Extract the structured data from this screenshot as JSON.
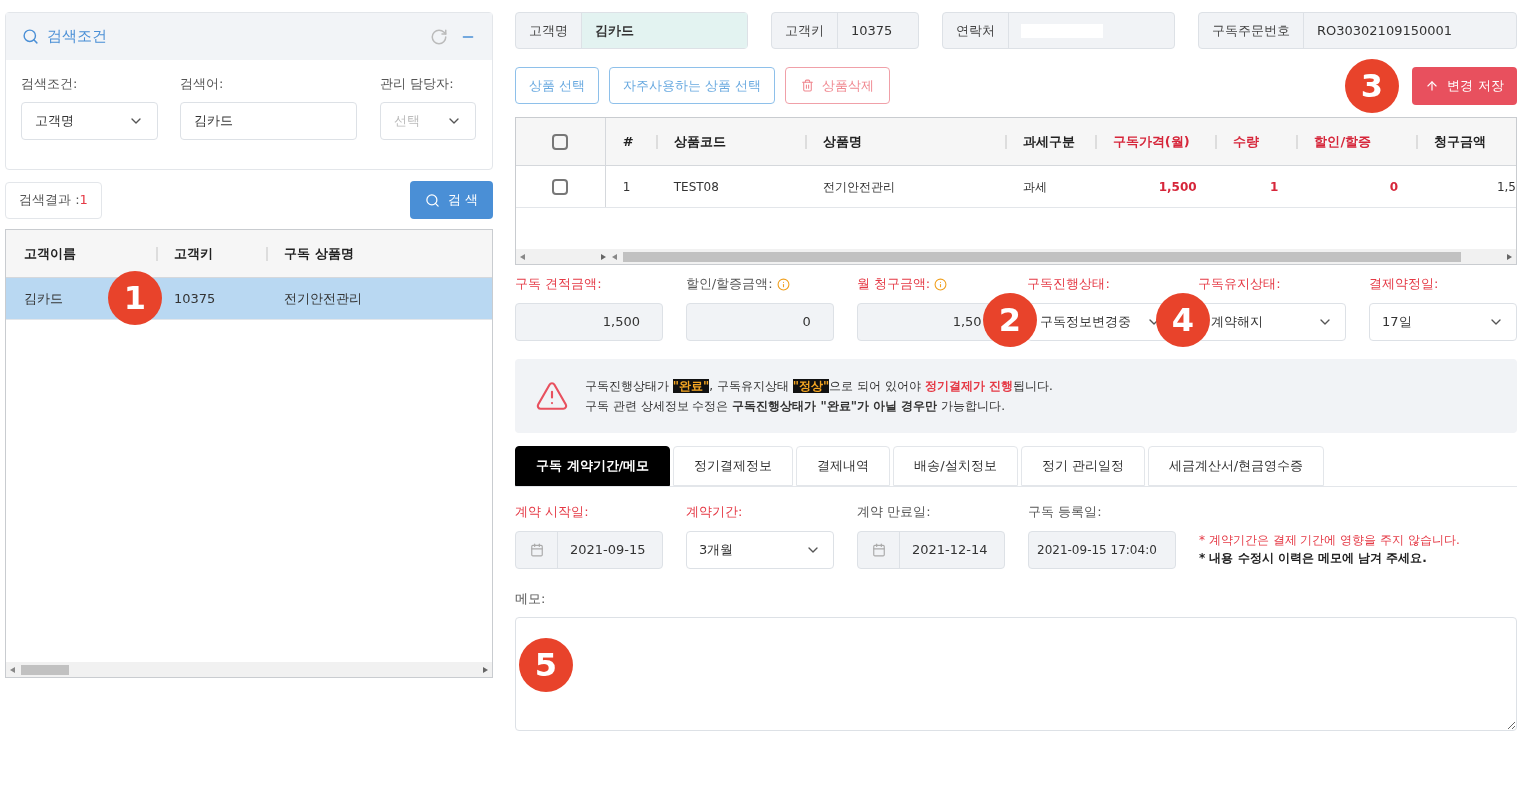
{
  "search_panel": {
    "title": "검색조건",
    "fields": [
      {
        "label": "검색조건:",
        "kind": "select",
        "value": "고객명"
      },
      {
        "label": "검색어:",
        "kind": "input",
        "value": "김카드"
      },
      {
        "label": "관리 담당자:",
        "kind": "select",
        "placeholder": "선택"
      }
    ],
    "result_label": "검색결과 : ",
    "result_count": "1",
    "search_button": "검 색"
  },
  "customer_table": {
    "columns": [
      "고객이름",
      "고객키",
      "구독 상품명"
    ],
    "rows": [
      {
        "cells": [
          "김카드",
          "10375",
          "전기안전관리"
        ],
        "selected": true
      }
    ]
  },
  "header_fields": [
    {
      "label": "고객명",
      "value": "김카드",
      "kind": "highlight"
    },
    {
      "label": "고객키",
      "value": "10375",
      "kind": "plain"
    },
    {
      "label": "연락처",
      "kind": "masked"
    },
    {
      "label": "구독주문번호",
      "value": "RO30302109150001",
      "kind": "plain"
    }
  ],
  "toolbar": {
    "buttons": [
      {
        "label": "상품 선택",
        "kind": "blue"
      },
      {
        "label": "자주사용하는 상품 선택",
        "kind": "blue"
      },
      {
        "label": "상품삭제",
        "kind": "danger"
      }
    ],
    "save_button": "변경 저장"
  },
  "product_table": {
    "columns": [
      {
        "label": "#",
        "required": false
      },
      {
        "label": "상품코드",
        "required": false
      },
      {
        "label": "상품명",
        "required": false
      },
      {
        "label": "과세구분",
        "required": false
      },
      {
        "label": "구독가격(월)",
        "required": true
      },
      {
        "label": "수량",
        "required": true
      },
      {
        "label": "할인/할증",
        "required": true
      },
      {
        "label": "청구금액",
        "required": false
      }
    ],
    "rows": [
      {
        "checked": false,
        "cells": [
          "1",
          "TEST08",
          "전기안전관리",
          "과세",
          "1,500",
          "1",
          "0",
          "1,5"
        ]
      }
    ],
    "header_checked": false
  },
  "amount_fields": [
    {
      "label": "구독 견적금액:",
      "required": true,
      "info": false,
      "kind": "amount",
      "value": "1,500"
    },
    {
      "label": "할인/할증금액:",
      "required": false,
      "info": true,
      "kind": "amount",
      "value": "0"
    },
    {
      "label": "월 청구금액:",
      "required": true,
      "info": true,
      "kind": "amount",
      "value": "1,50"
    },
    {
      "label": "구독진행상태:",
      "required": true,
      "info": false,
      "kind": "select",
      "value": "구독정보변경중"
    },
    {
      "label": "구독유지상태:",
      "required": true,
      "info": false,
      "kind": "select",
      "value": "계약해지"
    },
    {
      "label": "결제약정일:",
      "required": true,
      "info": false,
      "kind": "select",
      "value": "17일"
    }
  ],
  "notice": {
    "lines": [
      [
        {
          "text": "구독진행상태가 ",
          "kind": "plain"
        },
        {
          "text": "\"완료\"",
          "kind": "highlight"
        },
        {
          "text": ", 구독유지상태 ",
          "kind": "plain"
        },
        {
          "text": "\"정상\"",
          "kind": "highlight"
        },
        {
          "text": "으로 되어 있어야 ",
          "kind": "plain"
        },
        {
          "text": "정기결제가 진행",
          "kind": "red"
        },
        {
          "text": "됩니다.",
          "kind": "plain"
        }
      ],
      [
        {
          "text": "구독 관련 상세정보 수정은 ",
          "kind": "plain"
        },
        {
          "text": "구독진행상태가 \"완료\"가 아닐 경우만",
          "kind": "bold"
        },
        {
          "text": " 가능합니다.",
          "kind": "plain"
        }
      ]
    ]
  },
  "tabs": [
    {
      "label": "구독 계약기간/메모",
      "selected": true
    },
    {
      "label": "정기결제정보",
      "selected": false
    },
    {
      "label": "결제내역",
      "selected": false
    },
    {
      "label": "배송/설치정보",
      "selected": false
    },
    {
      "label": "정기 관리일정",
      "selected": false
    },
    {
      "label": "세금계산서/현금영수증",
      "selected": false
    }
  ],
  "contract_fields": [
    {
      "label": "계약 시작일:",
      "required": true,
      "kind": "date",
      "value": "2021-09-15"
    },
    {
      "label": "계약기간:",
      "required": true,
      "kind": "select",
      "value": "3개월"
    },
    {
      "label": "계약 만료일:",
      "required": false,
      "kind": "date",
      "value": "2021-12-14"
    },
    {
      "label": "구독 등록일:",
      "required": false,
      "kind": "text",
      "value": "2021-09-15 17:04:0"
    }
  ],
  "notes": [
    {
      "text": "* 계약기간은 결제 기간에 영향을 주지 않습니다.",
      "kind": "red"
    },
    {
      "text": "* 내용 수정시 이력은 메모에 남겨 주세요.",
      "kind": "bold"
    }
  ],
  "memo": {
    "label": "메모:"
  },
  "markers": [
    "1",
    "2",
    "3",
    "4",
    "5"
  ]
}
